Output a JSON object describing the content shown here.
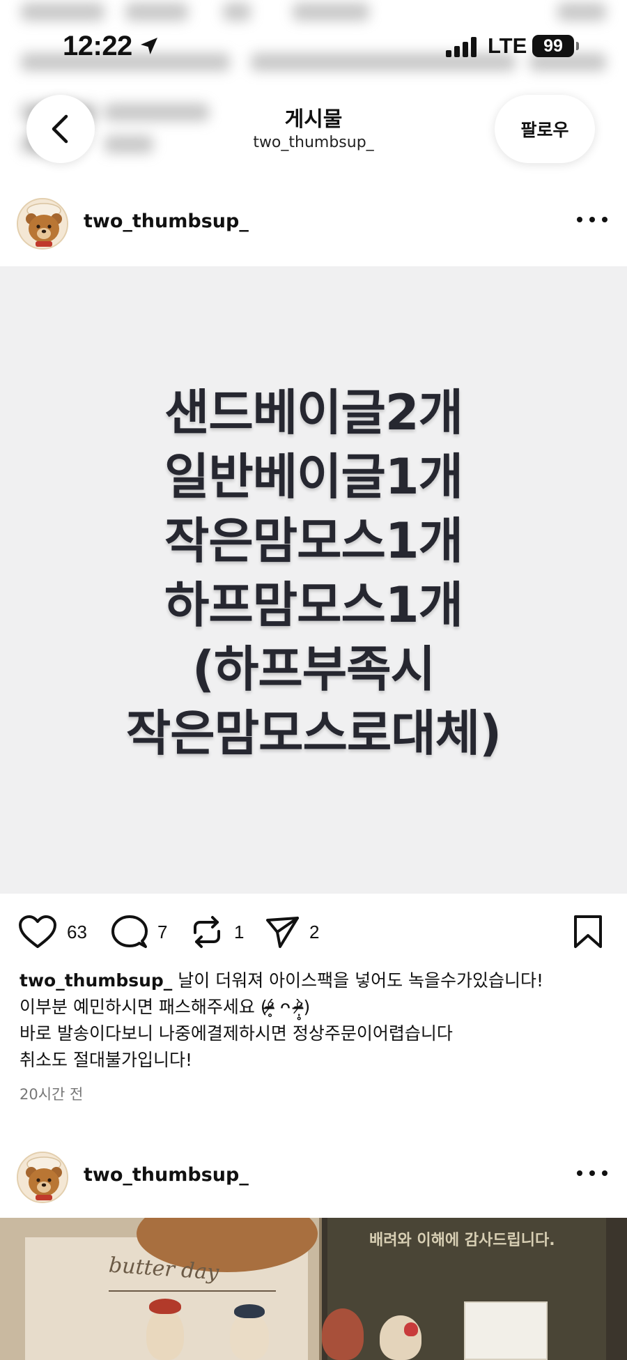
{
  "status_bar": {
    "time": "12:22",
    "network": "LTE",
    "battery": "99"
  },
  "header": {
    "title": "게시물",
    "subtitle": "two_thumbsup_",
    "follow_label": "팔로우"
  },
  "post1": {
    "username": "two_thumbsup_",
    "image_text": [
      "샌드베이글2개",
      "일반베이글1개",
      "작은맘모스1개",
      "하프맘모스1개",
      "(하프부족시",
      "작은맘모스로대체)"
    ],
    "likes": "63",
    "comments": "7",
    "reposts": "1",
    "shares": "2",
    "caption_user": "two_thumbsup_",
    "caption_lines": [
      "날이 더워져 아이스팩을 넣어도 녹을수가있습니다!",
      "이부분 예민하시면 패스해주세요 (ᵒ̴̶̷̥́ ᴖ ᵒ̴̶̷̣̥̀)",
      "바로 발송이다보니 나중에결제하시면 정상주문이어렵습니다",
      "취소도 절대불가입니다!"
    ],
    "timestamp": "20시간 전"
  },
  "post2": {
    "username": "two_thumbsup_",
    "image_frame_text": "butter day",
    "image_board_text": "배려와 이해에 감사드립니다."
  },
  "icons": [
    "back-icon",
    "location-arrow-icon",
    "signal-icon",
    "battery-icon",
    "more-icon",
    "heart-icon",
    "comment-icon",
    "repost-icon",
    "share-icon",
    "bookmark-icon"
  ]
}
